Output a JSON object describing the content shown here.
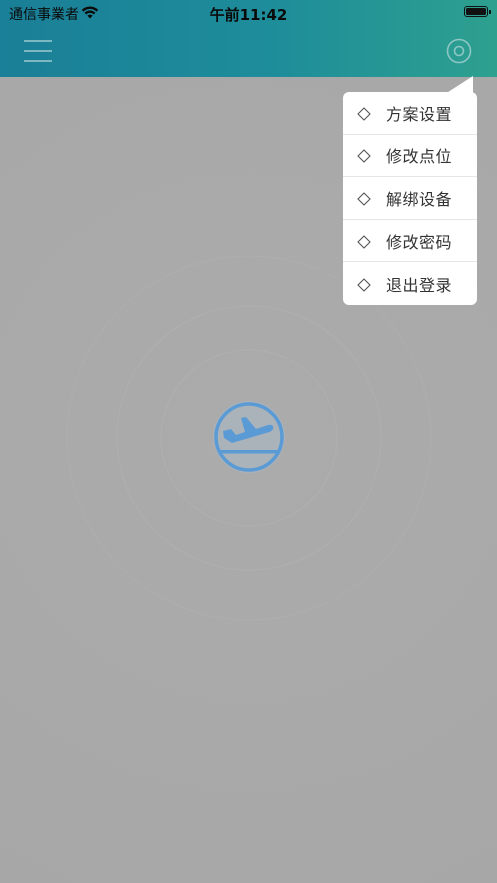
{
  "status_bar": {
    "carrier": "通信事業者",
    "time": "午前11:42"
  },
  "header": {
    "menu_icon": "hamburger-menu-icon",
    "settings_icon": "circle-target-icon"
  },
  "center": {
    "icon": "airplane-takeoff-icon"
  },
  "dropdown_menu": {
    "items": [
      {
        "icon": "diamond-icon",
        "label": "方案设置"
      },
      {
        "icon": "diamond-icon",
        "label": "修改点位"
      },
      {
        "icon": "diamond-icon",
        "label": "解绑设备"
      },
      {
        "icon": "diamond-icon",
        "label": "修改密码"
      },
      {
        "icon": "diamond-icon",
        "label": "退出登录"
      }
    ]
  },
  "colors": {
    "header_start": "#1a7f98",
    "header_end": "#2ea08f",
    "overlay": "#a7a7a7",
    "icon_blue": "#5b9bd5",
    "menu_text": "#333333"
  }
}
